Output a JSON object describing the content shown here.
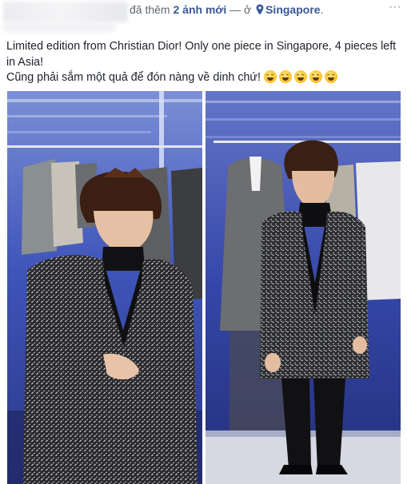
{
  "header": {
    "activity_prefix": "đã thêm",
    "photos_link": "2 ảnh mới",
    "separator": "— ở",
    "location": "Singapore",
    "period": ".",
    "more": "···"
  },
  "post": {
    "line1": "Limited edition from Christian Dior! Only one piece in Singapore, 4 pieces left in Asia!",
    "line2": "Cũng phải sắm một quả để đón nàng về dinh chứ!",
    "emoji_icon": "grinning-face-emoji",
    "emoji_count": 5
  },
  "colors": {
    "link": "#385898",
    "secondary_text": "#606770",
    "body_text": "#1d2129"
  }
}
